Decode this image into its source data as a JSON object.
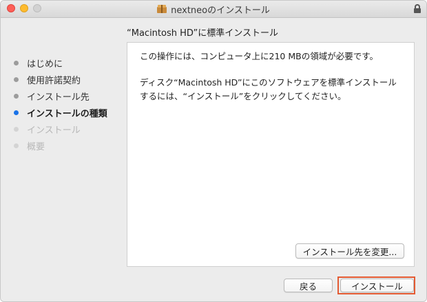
{
  "window": {
    "title": "nextneoのインストール"
  },
  "heading": "“Macintosh HD”に標準インストール",
  "sidebar": {
    "steps": [
      {
        "label": "はじめに",
        "state": "done"
      },
      {
        "label": "使用許諾契約",
        "state": "done"
      },
      {
        "label": "インストール先",
        "state": "done"
      },
      {
        "label": "インストールの種類",
        "state": "current"
      },
      {
        "label": "インストール",
        "state": "future"
      },
      {
        "label": "概要",
        "state": "future"
      }
    ]
  },
  "content": {
    "line1": "この操作には、コンピュータ上に210 MBの領域が必要です。",
    "line2": "ディスク“Macintosh HD”にこのソフトウェアを標準インストールするには、“インストール”をクリックしてください。",
    "change_location_label": "インストール先を変更..."
  },
  "footer": {
    "back_label": "戻る",
    "install_label": "インストール"
  },
  "colors": {
    "current_step_dot": "#1a73e8",
    "highlight_border": "#e45a32"
  }
}
